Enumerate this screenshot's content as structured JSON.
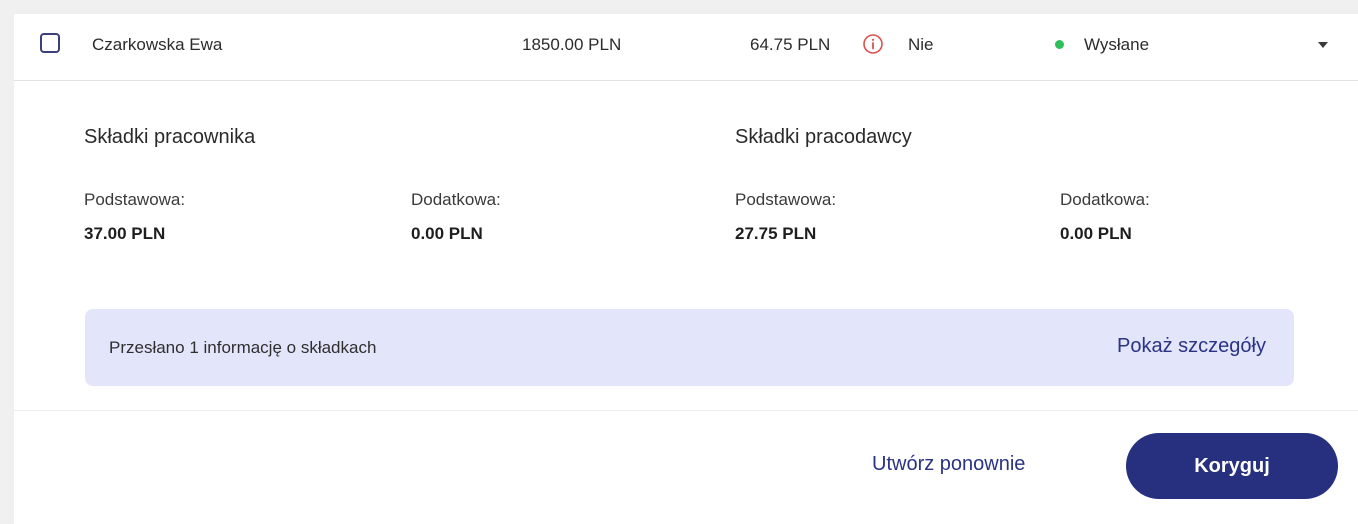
{
  "row": {
    "name": "Czarkowska Ewa",
    "gross": "1850.00 PLN",
    "contribution": "64.75 PLN",
    "flag": "Nie",
    "status": "Wysłane",
    "status_color": "#2fbf5a",
    "icons": [
      "checkbox",
      "info-circle-icon",
      "chevron-down-icon"
    ]
  },
  "details": {
    "employee": {
      "title": "Składki pracownika",
      "basic_label": "Podstawowa:",
      "basic_value": "37.00 PLN",
      "extra_label": "Dodatkowa:",
      "extra_value": "0.00 PLN"
    },
    "employer": {
      "title": "Składki pracodawcy",
      "basic_label": "Podstawowa:",
      "basic_value": "27.75 PLN",
      "extra_label": "Dodatkowa:",
      "extra_value": "0.00 PLN"
    },
    "banner": {
      "text": "Przesłano 1 informację o składkach",
      "link": "Pokaż szczegóły"
    }
  },
  "actions": {
    "recreate": "Utwórz ponownie",
    "correct": "Koryguj"
  },
  "colors": {
    "accent": "#27307f",
    "info_icon": "#d9534f",
    "banner_bg": "#e3e5fb"
  }
}
